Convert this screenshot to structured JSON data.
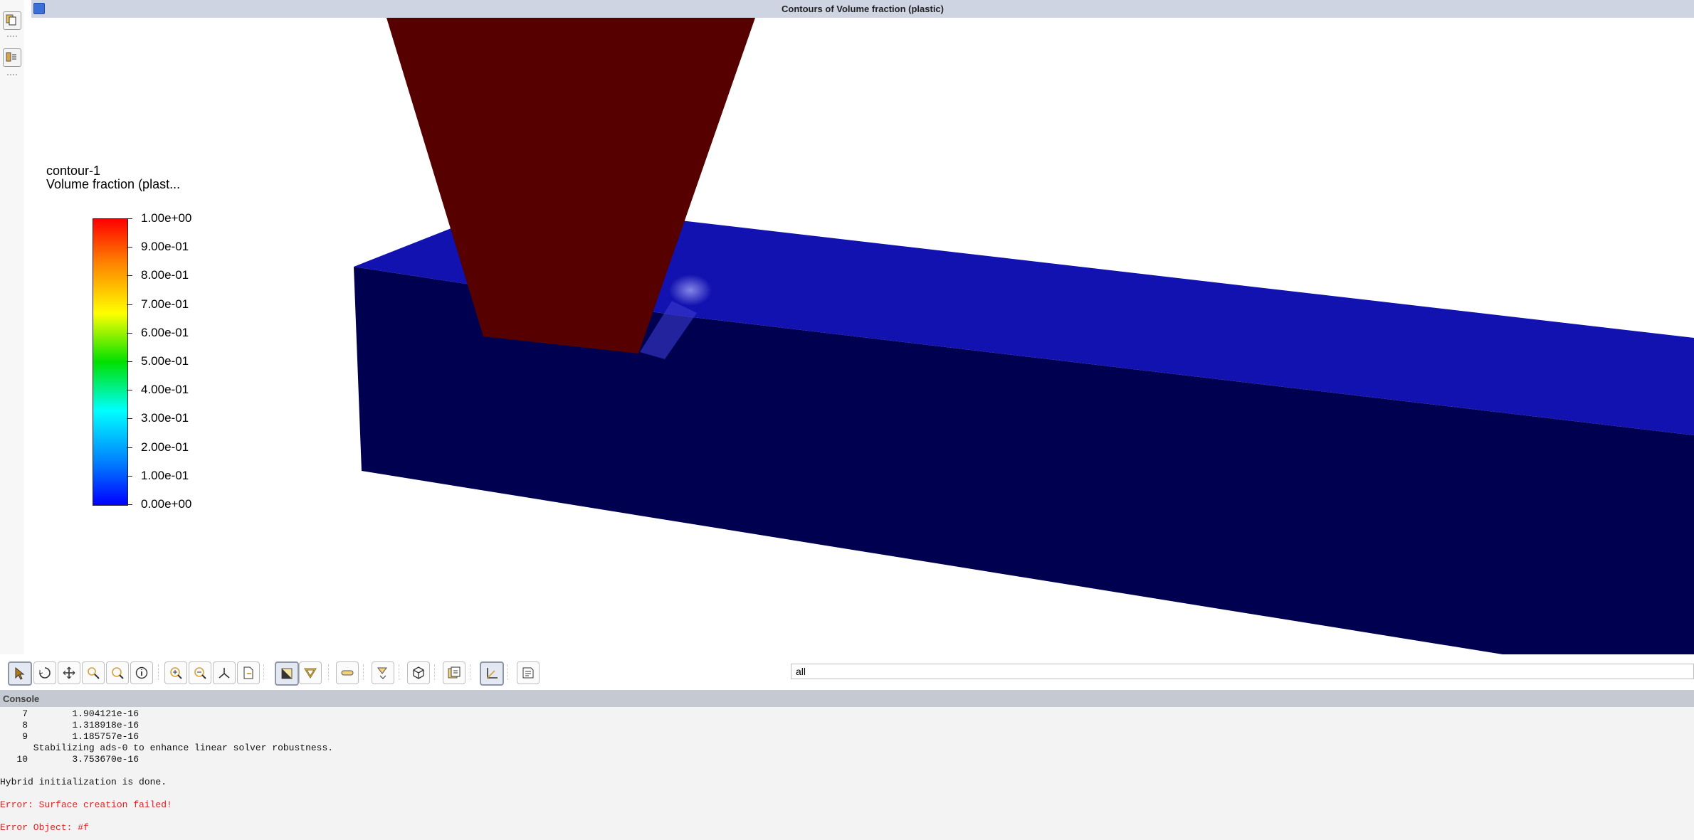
{
  "window": {
    "title": "Contours of Volume fraction (plastic)"
  },
  "left_toolbar": {
    "items": [
      {
        "name": "copy-icon"
      },
      {
        "name": "panel-layout-icon"
      }
    ]
  },
  "legend": {
    "contour_name": "contour-1",
    "variable": "Volume fraction (plast...",
    "ticks": [
      "1.00e+00",
      "9.00e-01",
      "8.00e-01",
      "7.00e-01",
      "6.00e-01",
      "5.00e-01",
      "4.00e-01",
      "3.00e-01",
      "2.00e-01",
      "1.00e-01",
      "0.00e+00"
    ],
    "colors": {
      "max": "#ff0000",
      "mid": "#00e000",
      "min": "#0000ff"
    }
  },
  "scene": {
    "colors": {
      "inlet_nozzle": "#560000",
      "block_top": "#1212b0",
      "block_front": "#000050",
      "interface": "#6f6fe6"
    }
  },
  "graphics_toolbar": {
    "buttons": [
      {
        "name": "select-pointer-icon",
        "active": true
      },
      {
        "name": "rotate-icon",
        "active": false
      },
      {
        "name": "pan-icon",
        "active": false
      },
      {
        "name": "zoom-icon",
        "active": false
      },
      {
        "name": "zoom-to-area-icon",
        "active": false
      },
      {
        "name": "probe-info-icon",
        "active": false
      },
      {
        "name": "fit-to-window-icon",
        "active": false
      },
      {
        "name": "zoom-out-icon",
        "active": false
      },
      {
        "name": "axes-view-icon",
        "active": false
      },
      {
        "name": "view-options-icon",
        "active": false
      },
      {
        "name": "lighting-icon",
        "active": true
      },
      {
        "name": "transparency-icon",
        "active": false
      },
      {
        "name": "ruler-icon",
        "active": false
      },
      {
        "name": "display-options-icon",
        "active": false
      },
      {
        "name": "cube-view-icon",
        "active": false
      },
      {
        "name": "save-picture-icon",
        "active": false
      },
      {
        "name": "axes-icon",
        "active": true
      },
      {
        "name": "notes-icon",
        "active": false
      }
    ],
    "surface_filter_value": "all"
  },
  "console": {
    "title": "Console",
    "lines": [
      {
        "text": "    7        1.904121e-16",
        "error": false
      },
      {
        "text": "    8        1.318918e-16",
        "error": false
      },
      {
        "text": "    9        1.185757e-16",
        "error": false
      },
      {
        "text": "      Stabilizing ads-0 to enhance linear solver robustness.",
        "error": false
      },
      {
        "text": "   10        3.753670e-16",
        "error": false
      },
      {
        "text": "",
        "error": false
      },
      {
        "text": "Hybrid initialization is done.",
        "error": false
      },
      {
        "text": "",
        "error": false
      },
      {
        "text": "Error: Surface creation failed!",
        "error": true
      },
      {
        "text": "",
        "error": false
      },
      {
        "text": "Error Object: #f",
        "error": true
      }
    ]
  }
}
